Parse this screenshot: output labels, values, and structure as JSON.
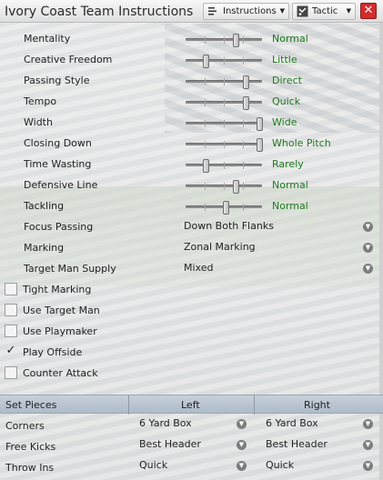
{
  "window": {
    "title": "Ivory Coast Team Instructions",
    "instructions_label": "Instructions",
    "tactic_label": "Tactic",
    "close_glyph": "✕"
  },
  "sliders": [
    {
      "label": "Mentality",
      "value": "Normal",
      "level": 0.65
    },
    {
      "label": "Creative Freedom",
      "value": "Little",
      "level": 0.26
    },
    {
      "label": "Passing Style",
      "value": "Direct",
      "level": 0.78
    },
    {
      "label": "Tempo",
      "value": "Quick",
      "level": 0.78
    },
    {
      "label": "Width",
      "value": "Wide",
      "level": 0.97
    },
    {
      "label": "Closing Down",
      "value": "Whole Pitch",
      "level": 0.97
    },
    {
      "label": "Time Wasting",
      "value": "Rarely",
      "level": 0.26
    },
    {
      "label": "Defensive Line",
      "value": "Normal",
      "level": 0.66
    },
    {
      "label": "Tackling",
      "value": "Normal",
      "level": 0.52
    }
  ],
  "dropdowns": [
    {
      "label": "Focus Passing",
      "value": "Down Both Flanks"
    },
    {
      "label": "Marking",
      "value": "Zonal Marking"
    },
    {
      "label": "Target Man Supply",
      "value": "Mixed"
    }
  ],
  "checkboxes": [
    {
      "label": "Tight Marking",
      "checked": false
    },
    {
      "label": "Use Target Man",
      "checked": false
    },
    {
      "label": "Use Playmaker",
      "checked": false
    },
    {
      "label": "Play Offside",
      "checked": true
    },
    {
      "label": "Counter Attack",
      "checked": false
    }
  ],
  "set_pieces": {
    "header": {
      "col0": "Set Pieces",
      "col1": "Left",
      "col2": "Right"
    },
    "rows": [
      {
        "label": "Corners",
        "left": "6 Yard Box",
        "right": "6 Yard Box"
      },
      {
        "label": "Free Kicks",
        "left": "Best Header",
        "right": "Best Header"
      },
      {
        "label": "Throw Ins",
        "left": "Quick",
        "right": "Quick"
      }
    ]
  },
  "colors": {
    "value_green": "#1f7a1f",
    "close_red": "#d42c2c",
    "set_pieces_header": "#b8c4d1"
  }
}
